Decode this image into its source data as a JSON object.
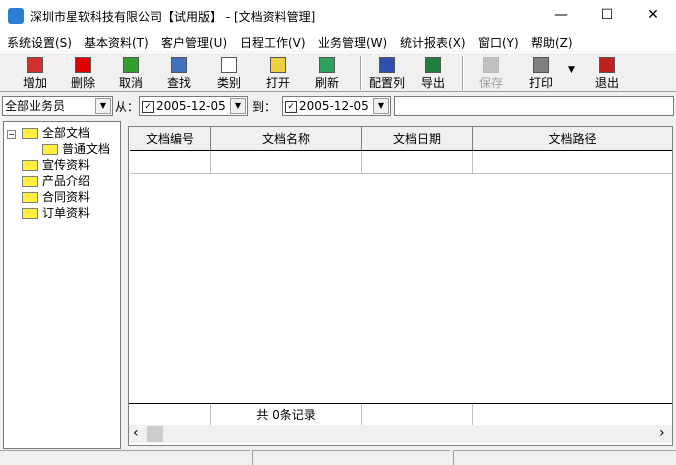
{
  "window": {
    "title": "深圳市星软科技有限公司【试用版】 - [文档资料管理]",
    "minimize": "—",
    "maximize": "☐",
    "close": "✕"
  },
  "menu": [
    "系统设置(S)",
    "基本资料(T)",
    "客户管理(U)",
    "日程工作(V)",
    "业务管理(W)",
    "统计报表(X)",
    "窗口(Y)",
    "帮助(Z)"
  ],
  "toolbar": [
    {
      "label": "增加",
      "icon": "add-doc-icon",
      "color": "#d03030"
    },
    {
      "label": "删除",
      "icon": "delete-x-icon",
      "color": "#e00000"
    },
    {
      "label": "取消",
      "icon": "undo-icon",
      "color": "#30a030"
    },
    {
      "label": "查找",
      "icon": "search-icon",
      "color": "#4070c0"
    },
    {
      "label": "类别",
      "icon": "category-tree-icon",
      "color": "#ffffff"
    },
    {
      "label": "打开",
      "icon": "open-folder-icon",
      "color": "#f0d040"
    },
    {
      "label": "刷新",
      "icon": "refresh-icon",
      "color": "#30a060"
    },
    {
      "label": "配置列",
      "icon": "grid-columns-icon",
      "color": "#3050b0"
    },
    {
      "label": "导出",
      "icon": "excel-export-icon",
      "color": "#208040"
    },
    {
      "label": "保存",
      "icon": "save-icon",
      "color": "#c0c0c0",
      "disabled": true
    },
    {
      "label": "打印",
      "icon": "printer-icon",
      "color": "#808080"
    },
    {
      "label": "退出",
      "icon": "exit-door-icon",
      "color": "#c02020"
    }
  ],
  "filter": {
    "staff": "全部业务员",
    "from_label": "从：",
    "from_date": "2005-12-05",
    "to_label": "到：",
    "to_date": "2005-12-05",
    "search": "",
    "from_checked": true,
    "to_checked": true
  },
  "tree": {
    "root": "全部文档",
    "child": "普通文档",
    "items": [
      "宣传资料",
      "产品介绍",
      "合同资料",
      "订单资料"
    ]
  },
  "grid": {
    "columns": [
      "文档编号",
      "文档名称",
      "文档日期",
      "文档路径"
    ],
    "footer": "共 0条记录"
  },
  "icons": {
    "checked": "✓",
    "dropdown": "▼",
    "left": "‹",
    "right": "›",
    "expand": "−"
  }
}
